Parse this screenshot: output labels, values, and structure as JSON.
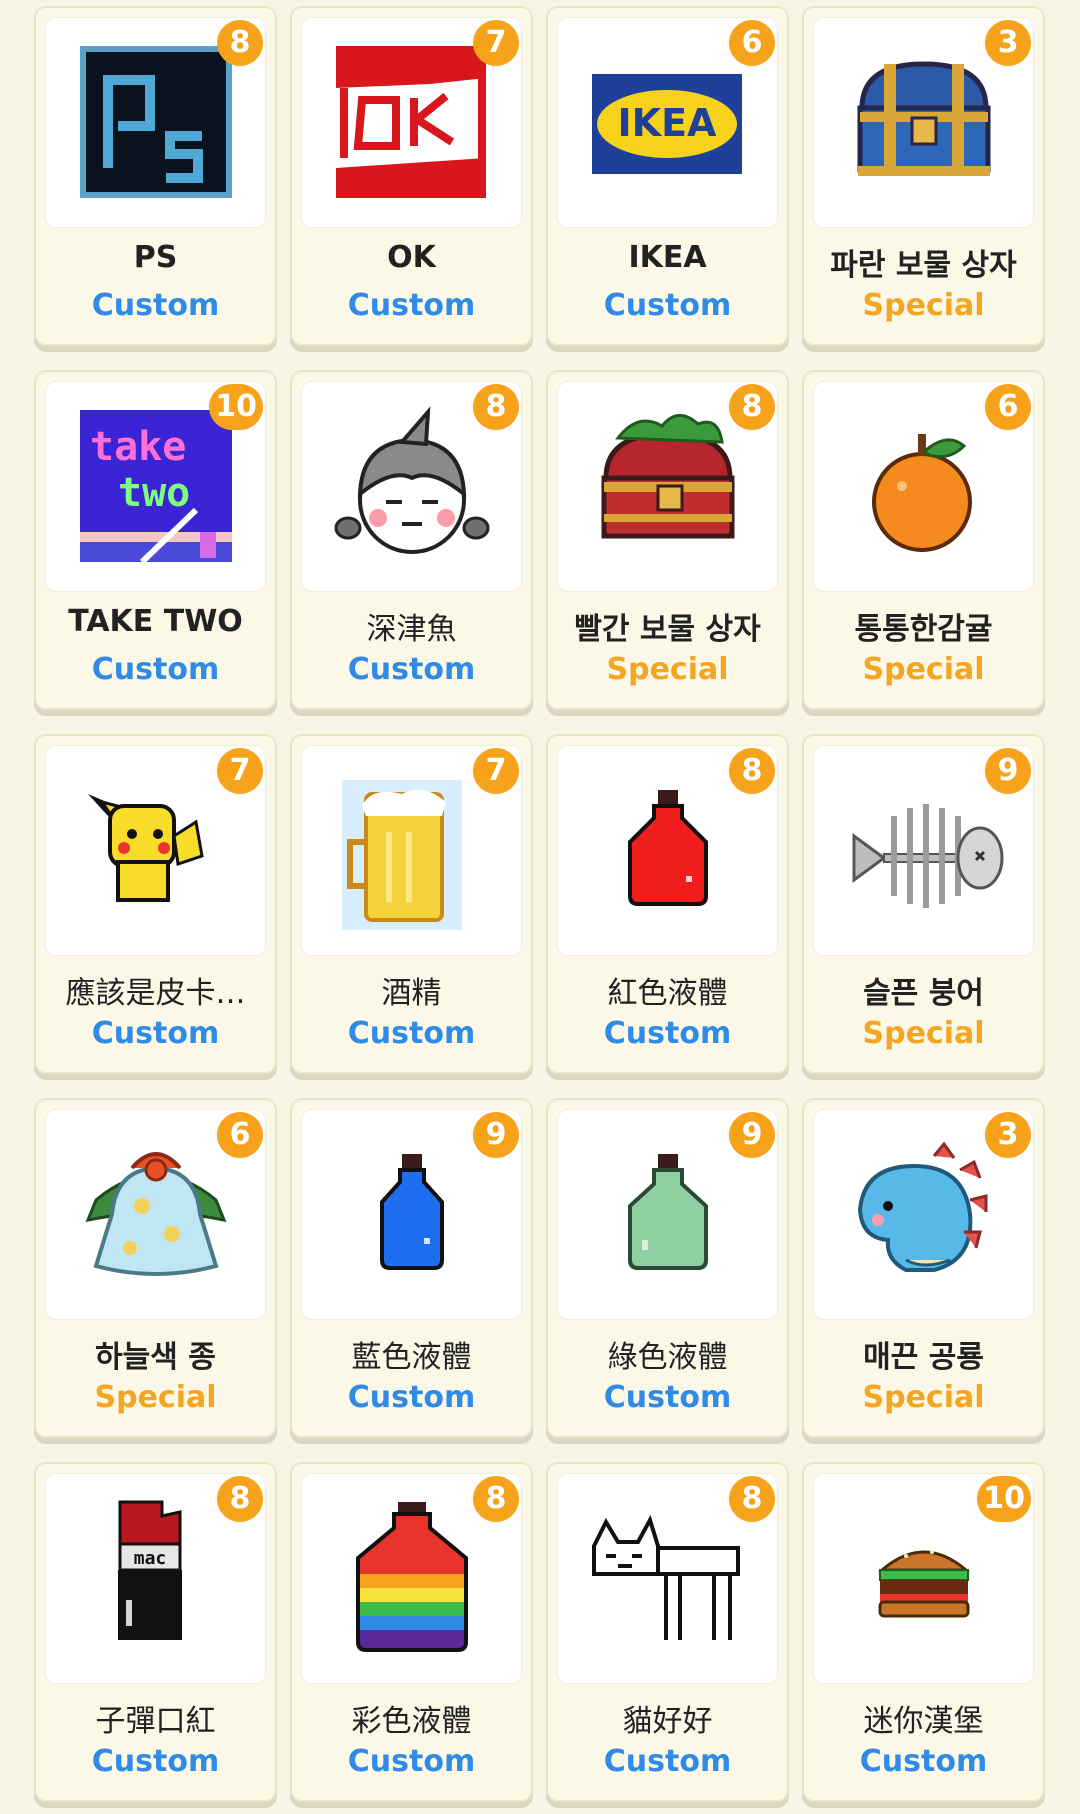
{
  "colors": {
    "badge": "#f7a21b",
    "custom": "#2f8be6",
    "special": "#f4a623",
    "background": "#f8f5e6"
  },
  "items": [
    {
      "name": "PS",
      "category": "Custom",
      "count": "8",
      "icon": "photoshop-logo-icon"
    },
    {
      "name": "OK",
      "category": "Custom",
      "count": "7",
      "icon": "ok-sign-icon"
    },
    {
      "name": "IKEA",
      "category": "Custom",
      "count": "6",
      "icon": "ikea-logo-icon"
    },
    {
      "name": "파란 보물 상자",
      "category": "Special",
      "count": "3",
      "icon": "blue-treasure-chest-icon"
    },
    {
      "name": "TAKE TWO",
      "category": "Custom",
      "count": "10",
      "icon": "take-two-art-icon"
    },
    {
      "name": "深津魚",
      "category": "Custom",
      "count": "8",
      "icon": "shark-hood-character-icon"
    },
    {
      "name": "빨간 보물 상자",
      "category": "Special",
      "count": "8",
      "icon": "red-treasure-chest-icon"
    },
    {
      "name": "통통한감귤",
      "category": "Special",
      "count": "6",
      "icon": "tangerine-icon"
    },
    {
      "name": "應該是皮卡…",
      "category": "Custom",
      "count": "7",
      "icon": "pikachu-icon"
    },
    {
      "name": "酒精",
      "category": "Custom",
      "count": "7",
      "icon": "beer-mug-icon"
    },
    {
      "name": "紅色液體",
      "category": "Custom",
      "count": "8",
      "icon": "red-potion-icon"
    },
    {
      "name": "슬픈 붕어",
      "category": "Special",
      "count": "9",
      "icon": "fish-skeleton-icon"
    },
    {
      "name": "하늘색 종",
      "category": "Special",
      "count": "6",
      "icon": "sky-blue-bell-icon"
    },
    {
      "name": "藍色液體",
      "category": "Custom",
      "count": "9",
      "icon": "blue-potion-icon"
    },
    {
      "name": "綠色液體",
      "category": "Custom",
      "count": "9",
      "icon": "green-potion-icon"
    },
    {
      "name": "매끈 공룡",
      "category": "Special",
      "count": "3",
      "icon": "blue-dinosaur-icon"
    },
    {
      "name": "子彈口紅",
      "category": "Custom",
      "count": "8",
      "icon": "lipstick-icon"
    },
    {
      "name": "彩色液體",
      "category": "Custom",
      "count": "8",
      "icon": "rainbow-potion-icon"
    },
    {
      "name": "貓好好",
      "category": "Custom",
      "count": "8",
      "icon": "doodle-cat-icon"
    },
    {
      "name": "迷你漢堡",
      "category": "Custom",
      "count": "10",
      "icon": "mini-burger-icon"
    }
  ]
}
